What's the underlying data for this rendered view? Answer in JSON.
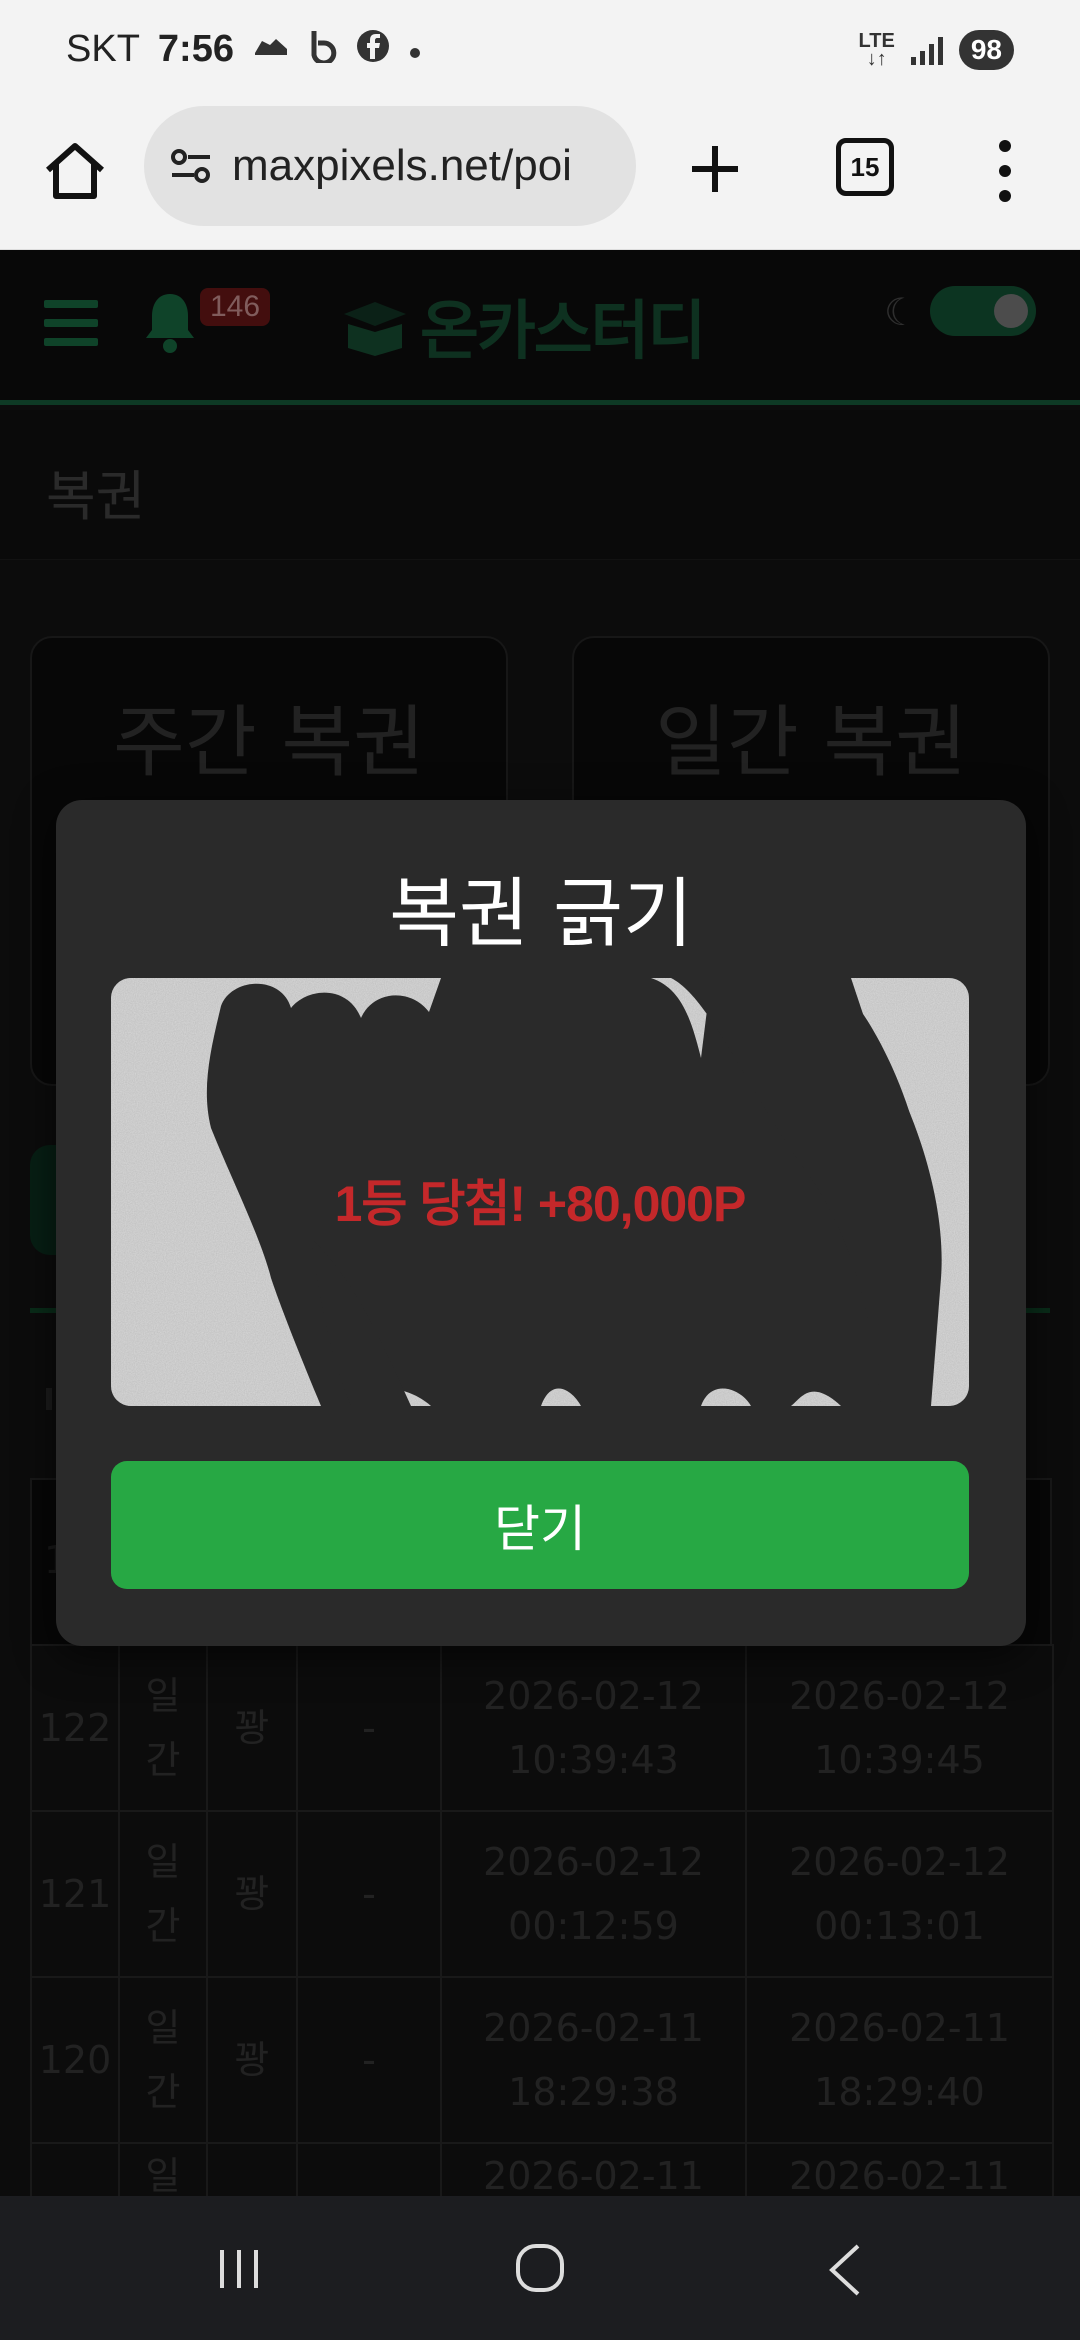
{
  "status_bar": {
    "carrier": "SKT",
    "time": "7:56",
    "notification_icons": [
      "shoe-icon",
      "b-app-icon",
      "facebook-icon",
      "dot-icon"
    ],
    "network": "LTE",
    "battery": "98"
  },
  "browser": {
    "url": "maxpixels.net/poi",
    "tab_count": "15"
  },
  "site": {
    "notification_count": "146",
    "logo_text": "온카스터디",
    "dark_mode_on": true,
    "colors": {
      "brand": "#1d7a4c",
      "header_bg": "#101010"
    }
  },
  "page": {
    "title": "복권",
    "cards": [
      {
        "label": "주간 복권"
      },
      {
        "label": "일간 복권"
      }
    ]
  },
  "table": {
    "header_first": "1",
    "rows": [
      {
        "no": "122",
        "type": "일간",
        "result": "꽝",
        "point": "-",
        "issued_date": "2026-02-12",
        "issued_time": "10:39:43",
        "used_date": "2026-02-12",
        "used_time": "10:39:45"
      },
      {
        "no": "121",
        "type": "일간",
        "result": "꽝",
        "point": "-",
        "issued_date": "2026-02-12",
        "issued_time": "00:12:59",
        "used_date": "2026-02-12",
        "used_time": "00:13:01"
      },
      {
        "no": "120",
        "type": "일간",
        "result": "꽝",
        "point": "-",
        "issued_date": "2026-02-11",
        "issued_time": "18:29:38",
        "used_date": "2026-02-11",
        "used_time": "18:29:40"
      },
      {
        "no": "",
        "type": "일",
        "result": "",
        "point": "",
        "issued_date": "2026-02-11",
        "issued_time": "",
        "used_date": "2026-02-11",
        "used_time": ""
      }
    ]
  },
  "modal": {
    "title": "복권 긁기",
    "prize_text": "1등 당첨! +80,000P",
    "close_label": "닫기",
    "colors": {
      "button": "#27a844",
      "prize": "#c4282a"
    }
  }
}
